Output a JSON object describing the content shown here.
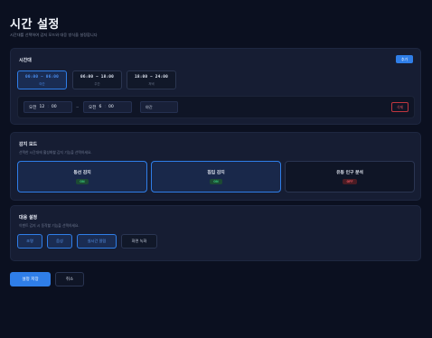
{
  "page": {
    "title": "시간 설정",
    "subtitle": "시간대를 선택하여 감지 모드와 대응 방식을 설정합니다"
  },
  "time_card": {
    "title": "시간대",
    "add_label": "추가",
    "chips": [
      {
        "range": "00:00 ~ 06:00",
        "label": "야간",
        "active": true
      },
      {
        "range": "06:00 ~ 18:00",
        "label": "주간",
        "active": false
      },
      {
        "range": "18:00 ~ 24:00",
        "label": "저녁",
        "active": false
      }
    ],
    "start": {
      "ampm": "오전",
      "hour": "12",
      "minute": "00"
    },
    "end": {
      "ampm": "오전",
      "hour": "6",
      "minute": "00"
    },
    "tilde": "~",
    "name_value": "야간",
    "delete_label": "삭제"
  },
  "detect_card": {
    "title": "감지 모드",
    "desc": "선택한 시간대에 활성화할 감지 기능을 선택하세요.",
    "modes": [
      {
        "name": "동선 감지",
        "status": "ON",
        "active": true
      },
      {
        "name": "침입 감지",
        "status": "ON",
        "active": true
      },
      {
        "name": "유동 인구 분석",
        "status": "OFF",
        "active": false
      }
    ]
  },
  "resp_card": {
    "title": "대응 설정",
    "desc": "이벤트 감지 시 동작할 기능을 선택하세요.",
    "options": [
      {
        "label": "조명",
        "active": true
      },
      {
        "label": "음성",
        "active": true
      },
      {
        "label": "실시간 알림",
        "active": true
      },
      {
        "label": "화면 녹화",
        "active": false
      }
    ]
  },
  "footer": {
    "save_label": "설정 저장",
    "cancel_label": "취소"
  },
  "colors": {
    "accent": "#2f7ee8",
    "on": "#38c779",
    "off": "#e0505a",
    "background": "#0b1020",
    "card": "#161d33"
  }
}
